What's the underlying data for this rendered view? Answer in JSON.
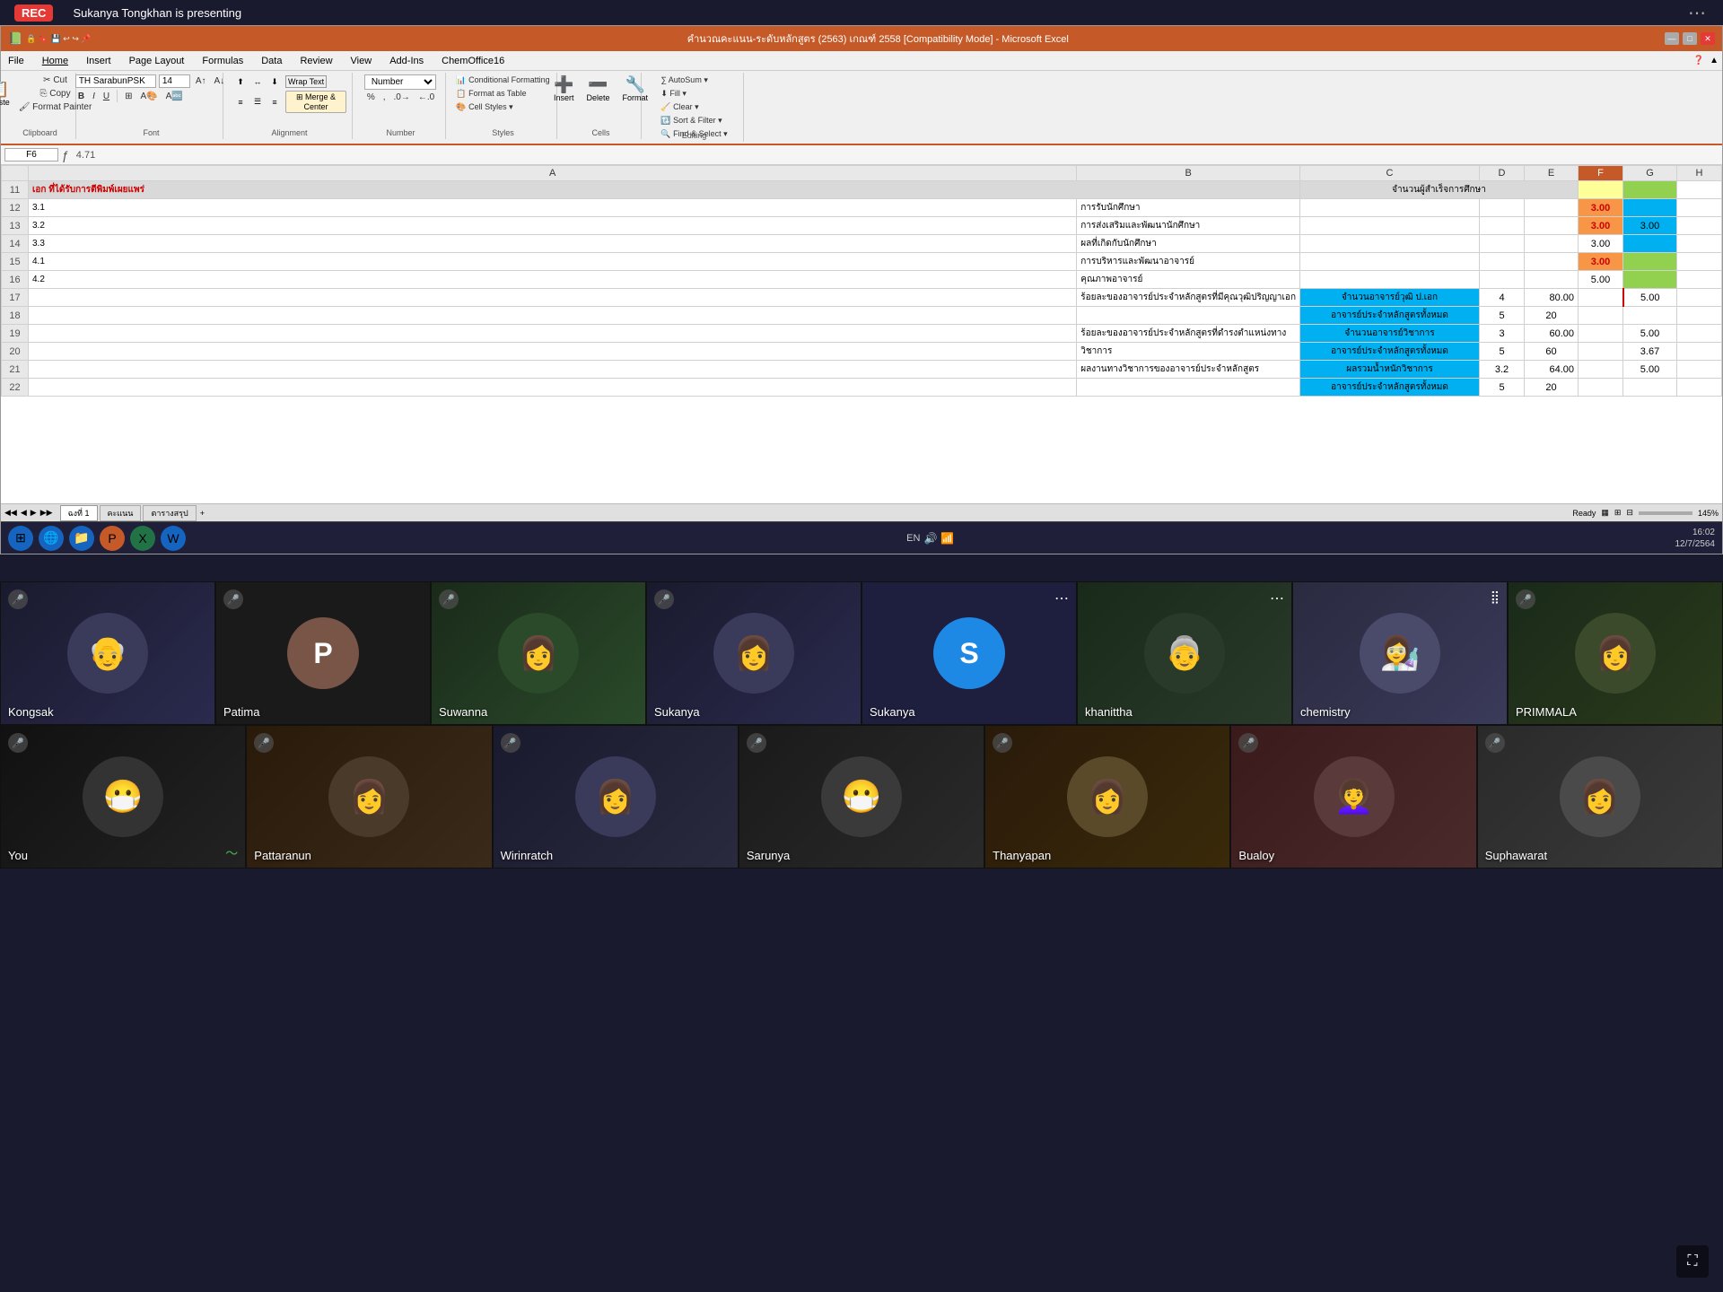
{
  "topbar": {
    "rec_label": "REC",
    "presenting_text": "Sukanya Tongkhan is presenting",
    "more_icon": "⋯"
  },
  "excel": {
    "title": "คำนวณคะแนน-ระดับหลักสูตร (2563) เกณฑ์ 2558 [Compatibility Mode] - Microsoft Excel",
    "window_controls": [
      "—",
      "□",
      "✕"
    ],
    "menu_items": [
      "File",
      "Home",
      "Insert",
      "Page Layout",
      "Formulas",
      "Data",
      "Review",
      "View",
      "Add-ins",
      "ChemOffice16"
    ],
    "ribbon": {
      "clipboard": {
        "label": "Clipboard",
        "cut": "Cut",
        "copy": "Copy",
        "paste": "Paste",
        "format_painter": "Format Painter"
      },
      "font": {
        "label": "Font",
        "font_name": "TH SarabunPSK",
        "font_size": "14",
        "bold": "B",
        "italic": "I",
        "underline": "U"
      },
      "alignment": {
        "label": "Alignment",
        "wrap_text": "Wrap Text",
        "merge_center": "Merge & Center"
      },
      "number": {
        "label": "Number",
        "format": "Number"
      },
      "styles": {
        "conditional_formatting": "Conditional Formatting",
        "format_as_table": "Format as Table",
        "cell_styles": "Cell Styles"
      },
      "cells": {
        "insert": "Insert",
        "delete": "Delete",
        "format": "Format"
      },
      "editing": {
        "autosum": "AutoSum",
        "fill": "Fill",
        "clear": "Clear",
        "sort_filter": "Sort & Filter",
        "find_select": "Find & Select"
      }
    },
    "formula_bar": {
      "cell_ref": "F6",
      "formula": "4.71"
    },
    "col_headers": [
      "",
      "A",
      "B",
      "C",
      "D",
      "E",
      "F",
      "G",
      "H"
    ],
    "rows": [
      {
        "row_num": "11",
        "cells": [
          "เอก ที่ได้รับการตีพิมพ์เผยแพร่",
          "",
          "จำนวนผู้สำเร็จการศึกษา",
          "",
          "",
          "",
          "",
          ""
        ]
      },
      {
        "row_num": "12",
        "cells": [
          "3.1",
          "การรับนักศึกษา",
          "",
          "",
          "",
          "",
          "3.00",
          "",
          ""
        ]
      },
      {
        "row_num": "13",
        "cells": [
          "3.2",
          "การส่งเสริมและพัฒนานักศึกษา",
          "",
          "",
          "",
          "",
          "3.00",
          "3.00",
          ""
        ]
      },
      {
        "row_num": "14",
        "cells": [
          "3.3",
          "ผลที่เกิดกับนักศึกษา",
          "",
          "",
          "",
          "",
          "3.00",
          "",
          ""
        ]
      },
      {
        "row_num": "15",
        "cells": [
          "4.1",
          "การบริหารและพัฒนาอาจารย์",
          "",
          "",
          "",
          "",
          "3.00",
          "",
          ""
        ]
      },
      {
        "row_num": "16",
        "cells": [
          "4.2",
          "คุณภาพอาจารย์",
          "",
          "",
          "",
          "",
          "5.00",
          "",
          ""
        ]
      },
      {
        "row_num": "17",
        "cells": [
          "",
          "ร้อยละของอาจารย์ประจำหลักสูตรที่มีคุณวุฒิปริญญาเอก",
          "จำนวนอาจารย์วุฒิ ป.เอก",
          "4",
          "80.00",
          "",
          "5.00",
          "",
          ""
        ]
      },
      {
        "row_num": "18",
        "cells": [
          "",
          "",
          "อาจารย์ประจำหลักสูตรทั้งหมด",
          "5",
          "20",
          "",
          "",
          "",
          ""
        ]
      },
      {
        "row_num": "19",
        "cells": [
          "",
          "ร้อยละของอาจารย์ประจำหลักสูตรที่ดำรงตำแหน่งทาง",
          "จำนวนอาจารย์วิชาการ",
          "3",
          "60.00",
          "",
          "5.00",
          "",
          ""
        ]
      },
      {
        "row_num": "20",
        "cells": [
          "",
          "วิชาการ",
          "อาจารย์ประจำหลักสูตรทั้งหมด",
          "5",
          "60",
          "",
          "",
          "3.67",
          ""
        ]
      },
      {
        "row_num": "21",
        "cells": [
          "",
          "ผลงานทางวิชาการของอาจารย์ประจำหลักสูตร",
          "ผลรวมน้ำหนักวิชาการ",
          "3.2",
          "64.00",
          "",
          "5.00",
          "",
          ""
        ]
      },
      {
        "row_num": "22",
        "cells": [
          "",
          "",
          "อาจารย์ประจำหลักสูตรทั้งหมด",
          "5",
          "20",
          "",
          "",
          "",
          ""
        ]
      }
    ],
    "tabs": [
      "ฉงที่ 1",
      "คะแนน",
      "ตารางสรุป"
    ],
    "status": "Ready",
    "zoom": "145%"
  },
  "taskbar": {
    "apps": [
      "⊞",
      "🌐",
      "📁",
      "🎨",
      "📊",
      "W"
    ],
    "time": "16:02",
    "date": "12/7/2564",
    "lang": "EN"
  },
  "video_participants": [
    {
      "name": "Kongsak",
      "type": "photo",
      "muted": true,
      "bg": "#1a1a2e"
    },
    {
      "name": "Patima",
      "type": "avatar",
      "avatar_letter": "P",
      "avatar_color": "#795548",
      "muted": true,
      "bg": "#1a1a2e"
    },
    {
      "name": "Suwanna",
      "type": "photo",
      "muted": true,
      "bg": "#1a3a1a"
    },
    {
      "name": "Sukanya",
      "type": "photo",
      "muted": true,
      "bg": "#1a1a2e"
    },
    {
      "name": "Sukanya",
      "type": "avatar",
      "avatar_letter": "S",
      "avatar_color": "#1e88e5",
      "muted": false,
      "dots": true,
      "bg": "#1e1e3a"
    },
    {
      "name": "khanittha",
      "type": "photo",
      "muted": false,
      "dots": true,
      "bg": "#1a3a1a"
    },
    {
      "name": "chemistry",
      "type": "photo",
      "muted": false,
      "bars": true,
      "bg": "#2a2a40"
    },
    {
      "name": "PRIMMALA",
      "type": "photo",
      "muted": true,
      "bg": "#1a2a1a"
    }
  ],
  "video_participants_bottom": [
    {
      "name": "You",
      "type": "photo",
      "muted": true,
      "wave": true,
      "bg": "#1a1a2e"
    },
    {
      "name": "Pattaranun",
      "type": "photo",
      "muted": true,
      "bg": "#2a1a0a"
    },
    {
      "name": "Wirinratch",
      "type": "photo",
      "muted": true,
      "bg": "#1a1a2e"
    },
    {
      "name": "Sarunya",
      "type": "photo",
      "muted": true,
      "bg": "#1a1a2e"
    },
    {
      "name": "Thanyapan",
      "type": "photo",
      "muted": true,
      "bg": "#2a1a0a"
    },
    {
      "name": "Bualoy",
      "type": "photo",
      "muted": true,
      "bg": "#3a1a1a"
    },
    {
      "name": "Suphawarat",
      "type": "photo",
      "muted": true,
      "bg": "#2a2a2a"
    }
  ]
}
